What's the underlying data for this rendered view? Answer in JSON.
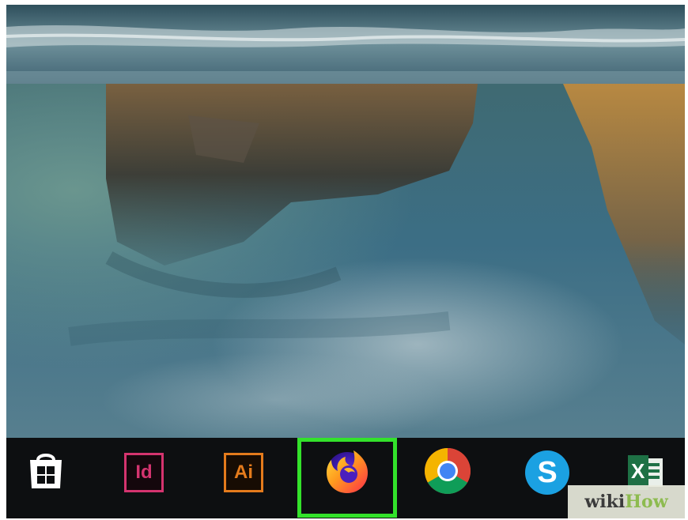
{
  "taskbar": {
    "items": [
      {
        "id": "store",
        "icon": "microsoft-store-icon"
      },
      {
        "id": "indesign",
        "icon": "adobe-indesign-icon",
        "label": "Id",
        "color": "#d4346f"
      },
      {
        "id": "illustrator",
        "icon": "adobe-illustrator-icon",
        "label": "Ai",
        "color": "#e47b1c"
      },
      {
        "id": "firefox",
        "icon": "firefox-icon",
        "highlighted": true
      },
      {
        "id": "chrome",
        "icon": "chrome-icon"
      },
      {
        "id": "skype",
        "icon": "skype-icon",
        "label": "S",
        "color": "#1ba1e2"
      },
      {
        "id": "excel",
        "icon": "excel-icon",
        "label": "X",
        "color": "#1e7145"
      }
    ],
    "highlight_color": "#33e22b"
  },
  "watermark": {
    "part1": "wiki",
    "part2": "How"
  }
}
